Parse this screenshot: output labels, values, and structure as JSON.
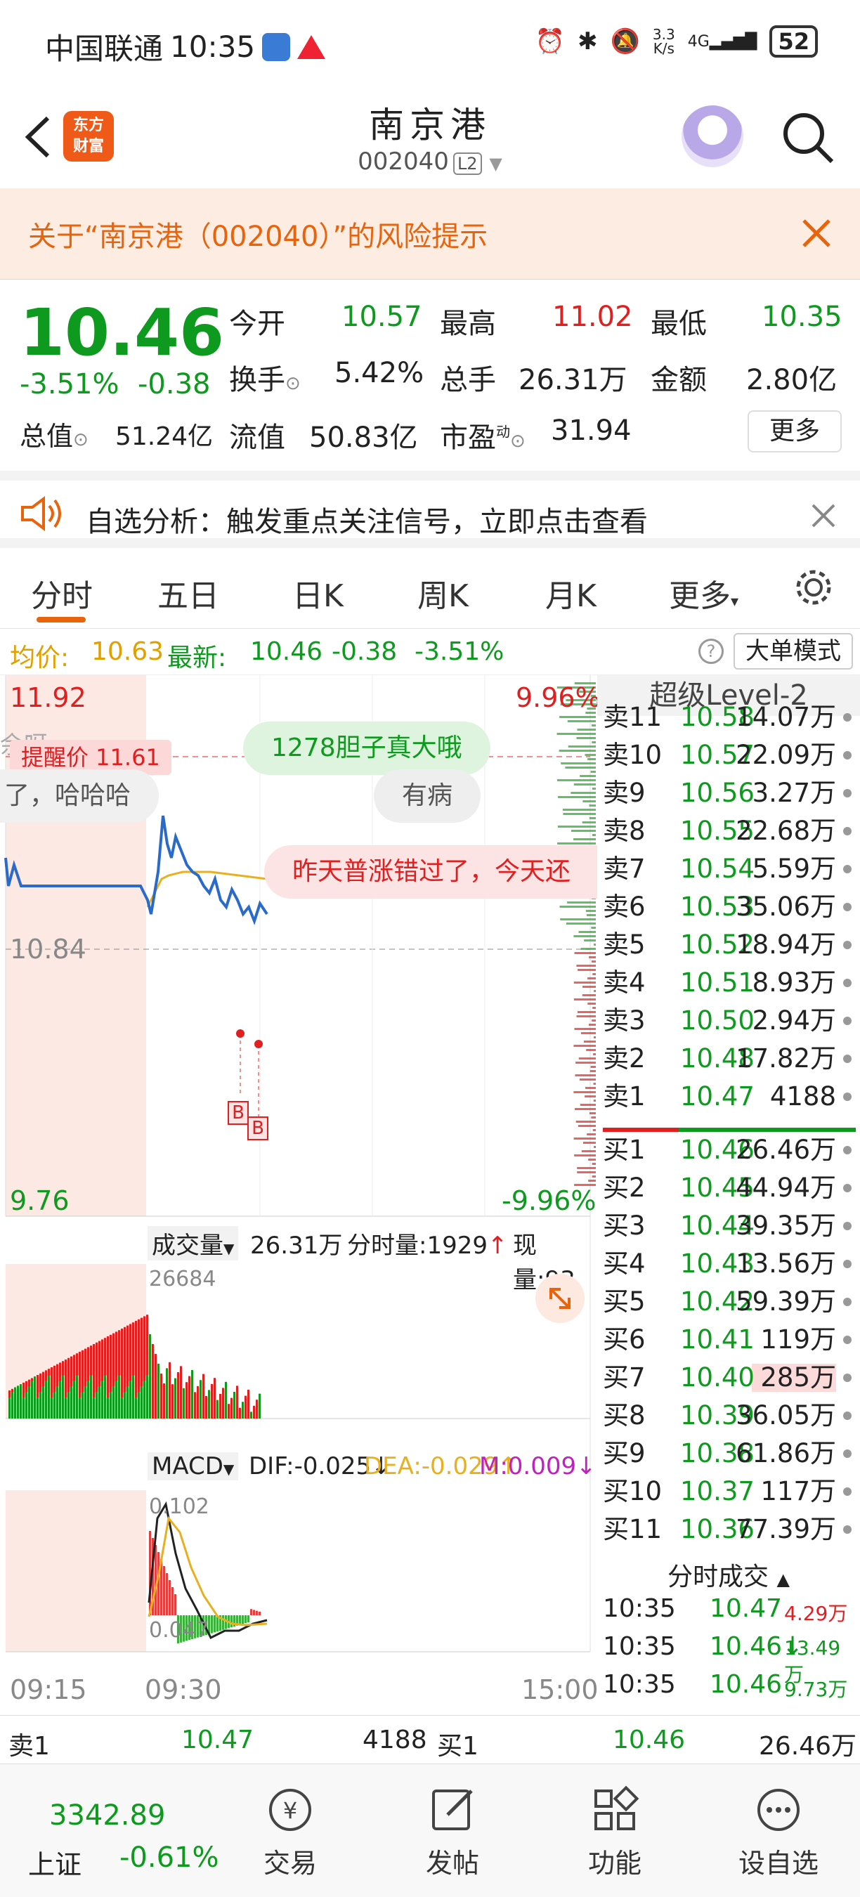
{
  "status": {
    "carrier": "中国联通",
    "time": "10:35",
    "speed_top": "3.3",
    "speed_bottom": "K/s",
    "net": "4G",
    "battery": "52"
  },
  "header": {
    "title": "南京港",
    "code": "002040",
    "level": "L2",
    "logo_line1": "东方",
    "logo_line2": "财富"
  },
  "risk": {
    "text": "关于“南京港（002040）”的风险提示"
  },
  "quote": {
    "price": "10.46",
    "pct": "-3.51%",
    "chg": "-0.38",
    "open_label": "今开",
    "open": "10.57",
    "high_label": "最高",
    "high": "11.02",
    "low_label": "最低",
    "low": "10.35",
    "turnover_label": "换手",
    "turnover": "5.42%",
    "volume_label": "总手",
    "volume": "26.31万",
    "amount_label": "金额",
    "amount": "2.80亿",
    "mktcap_label": "总值",
    "mktcap": "51.24亿",
    "float_label": "流值",
    "float": "50.83亿",
    "pe_label": "市盈",
    "pe_sup": "动",
    "pe": "31.94",
    "more": "更多"
  },
  "announce": {
    "text": "自选分析：触发重点关注信号，立即点击查看"
  },
  "tabs": [
    "分时",
    "五日",
    "日K",
    "周K",
    "月K",
    "更多"
  ],
  "avg_bar": {
    "avg_label": "均价:",
    "avg": "10.63",
    "latest_label": "最新:",
    "latest": "10.46",
    "chg": "-0.38",
    "pct": "-3.51%",
    "mode_button": "大单模式"
  },
  "chart": {
    "y_top": "11.92",
    "y_mid": "10.84",
    "y_bottom": "9.76",
    "pct_top": "9.96%",
    "pct_bottom": "-9.96%",
    "alert": "提醒价 11.61",
    "b1": "B",
    "b2": "B",
    "time_start": "09:15",
    "time_open": "09:30",
    "time_end": "15:00",
    "vol_label": "成交量",
    "vol_total": "26.31万",
    "vol_min_label": "分时量:1929",
    "vol_now_label": "现量:93",
    "vol_axis": "26684",
    "macd_label": "MACD",
    "dif": "DIF:-0.025",
    "dea": "DEA:-0.029",
    "m": "M:0.009",
    "macd_top": "0.102",
    "macd_bottom": "0.047"
  },
  "danmaku": [
    "余呀",
    "1278胆子真大哦",
    "了，哈哈哈",
    "有病",
    "昨天普涨错过了，今天还"
  ],
  "orderbook": {
    "title": "超级Level-2",
    "sells": [
      {
        "label": "卖11",
        "price": "10.58",
        "vol": "14.07万"
      },
      {
        "label": "卖10",
        "price": "10.57",
        "vol": "22.09万"
      },
      {
        "label": "卖9",
        "price": "10.56",
        "vol": "3.27万"
      },
      {
        "label": "卖8",
        "price": "10.55",
        "vol": "22.68万"
      },
      {
        "label": "卖7",
        "price": "10.54",
        "vol": "5.59万"
      },
      {
        "label": "卖6",
        "price": "10.53",
        "vol": "35.06万"
      },
      {
        "label": "卖5",
        "price": "10.52",
        "vol": "18.94万"
      },
      {
        "label": "卖4",
        "price": "10.51",
        "vol": "8.93万"
      },
      {
        "label": "卖3",
        "price": "10.50",
        "vol": "2.94万"
      },
      {
        "label": "卖2",
        "price": "10.48",
        "vol": "17.82万"
      },
      {
        "label": "卖1",
        "price": "10.47",
        "vol": "4188"
      }
    ],
    "buys": [
      {
        "label": "买1",
        "price": "10.46",
        "vol": "26.46万"
      },
      {
        "label": "买2",
        "price": "10.45",
        "vol": "44.94万"
      },
      {
        "label": "买3",
        "price": "10.44",
        "vol": "39.35万"
      },
      {
        "label": "买4",
        "price": "10.43",
        "vol": "13.56万"
      },
      {
        "label": "买5",
        "price": "10.42",
        "vol": "59.39万"
      },
      {
        "label": "买6",
        "price": "10.41",
        "vol": "119万"
      },
      {
        "label": "买7",
        "price": "10.40",
        "vol": "285万"
      },
      {
        "label": "买8",
        "price": "10.39",
        "vol": "36.05万"
      },
      {
        "label": "买9",
        "price": "10.38",
        "vol": "61.86万"
      },
      {
        "label": "买10",
        "price": "10.37",
        "vol": "117万"
      },
      {
        "label": "买11",
        "price": "10.36",
        "vol": "77.39万"
      }
    ],
    "trades_title": "分时成交",
    "trades": [
      {
        "time": "10:35",
        "price": "10.47",
        "vol": "4.29万"
      },
      {
        "time": "10:35",
        "price": "10.46↓",
        "vol": "13.49万"
      },
      {
        "time": "10:35",
        "price": "10.46",
        "vol": "9.73万"
      }
    ]
  },
  "bottom_quote": {
    "sell_label": "卖1",
    "sell_price": "10.47",
    "sell_vol": "4188",
    "buy_label": "买1",
    "buy_price": "10.46",
    "buy_vol": "26.46万"
  },
  "nav": {
    "index_value": "3342.89",
    "index_name": "上证",
    "index_pct": "-0.61%",
    "trade": "交易",
    "post": "发帖",
    "function": "功能",
    "watch": "设自选"
  },
  "colors": {
    "up": "#e02020",
    "down": "#0e9a1e",
    "accent": "#e8640c"
  }
}
